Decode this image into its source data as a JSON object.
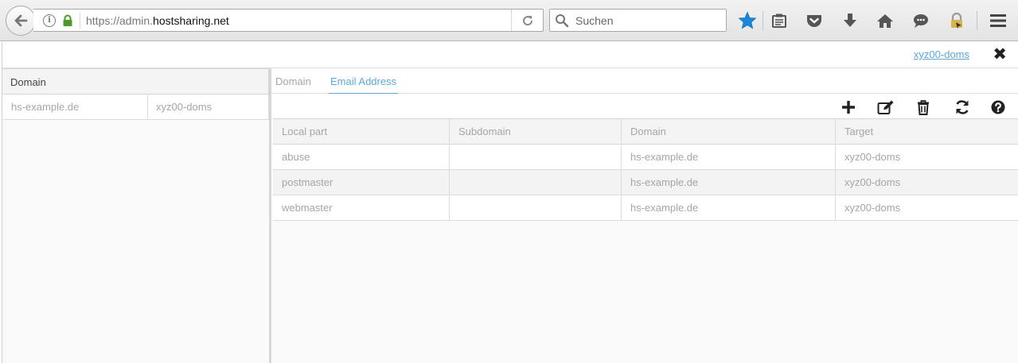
{
  "browser": {
    "url_prefix": "https://admin.",
    "url_domain": "hostsharing.net",
    "search_placeholder": "Suchen"
  },
  "header": {
    "user_link": "xyz00-doms",
    "close_glyph": "✖"
  },
  "left": {
    "column_header": "Domain",
    "rows": [
      {
        "domain": "hs-example.de",
        "owner": "xyz00-doms"
      }
    ]
  },
  "tabs": [
    {
      "label": "Domain",
      "active": false
    },
    {
      "label": "Email Address",
      "active": true
    }
  ],
  "actions": [
    "plus-icon",
    "edit-icon",
    "trash-icon",
    "refresh-icon",
    "help-icon"
  ],
  "table": {
    "columns": [
      "Local part",
      "Subdomain",
      "Domain",
      "Target"
    ],
    "rows": [
      {
        "local_part": "abuse",
        "subdomain": "",
        "domain": "hs-example.de",
        "target": "xyz00-doms"
      },
      {
        "local_part": "postmaster",
        "subdomain": "",
        "domain": "hs-example.de",
        "target": "xyz00-doms"
      },
      {
        "local_part": "webmaster",
        "subdomain": "",
        "domain": "hs-example.de",
        "target": "xyz00-doms"
      }
    ]
  },
  "colors": {
    "accent": "#5aa9d6",
    "star": "#1a88d8",
    "lock": "#4a9a2a"
  }
}
